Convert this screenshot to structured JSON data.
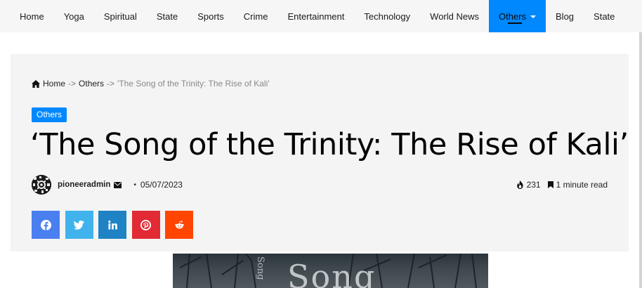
{
  "nav": {
    "items": [
      {
        "label": "Home"
      },
      {
        "label": "Yoga"
      },
      {
        "label": "Spiritual"
      },
      {
        "label": "State"
      },
      {
        "label": "Sports"
      },
      {
        "label": "Crime"
      },
      {
        "label": "Entertainment"
      },
      {
        "label": "Technology"
      },
      {
        "label": "World News"
      },
      {
        "label": "Others",
        "active": true
      },
      {
        "label": "Blog"
      },
      {
        "label": "State"
      }
    ],
    "accent_color": "#0088ff"
  },
  "breadcrumb": {
    "home": "Home",
    "sep1": "->",
    "category": "Others",
    "sep2": "->",
    "current": "'The Song of the Trinity: The Rise of Kali'"
  },
  "article": {
    "category_badge": "Others",
    "title": "‘The Song of the Trinity: The Rise of Kali’",
    "author": "pioneeradmin",
    "date": "05/07/2023",
    "views": "231",
    "read_time": "1 minute read"
  },
  "share": [
    {
      "network": "facebook",
      "icon": "facebook-icon",
      "color": "#4a7ff0"
    },
    {
      "network": "twitter",
      "icon": "twitter-icon",
      "color": "#40b3ec"
    },
    {
      "network": "linkedin",
      "icon": "linkedin-icon",
      "color": "#1f82c4"
    },
    {
      "network": "pinterest",
      "icon": "pinterest-icon",
      "color": "#e12a34"
    },
    {
      "network": "reddit",
      "icon": "reddit-icon",
      "color": "#ff4500"
    }
  ],
  "featured_image": {
    "visible_text_large": "Song",
    "visible_text_small": "Song"
  }
}
